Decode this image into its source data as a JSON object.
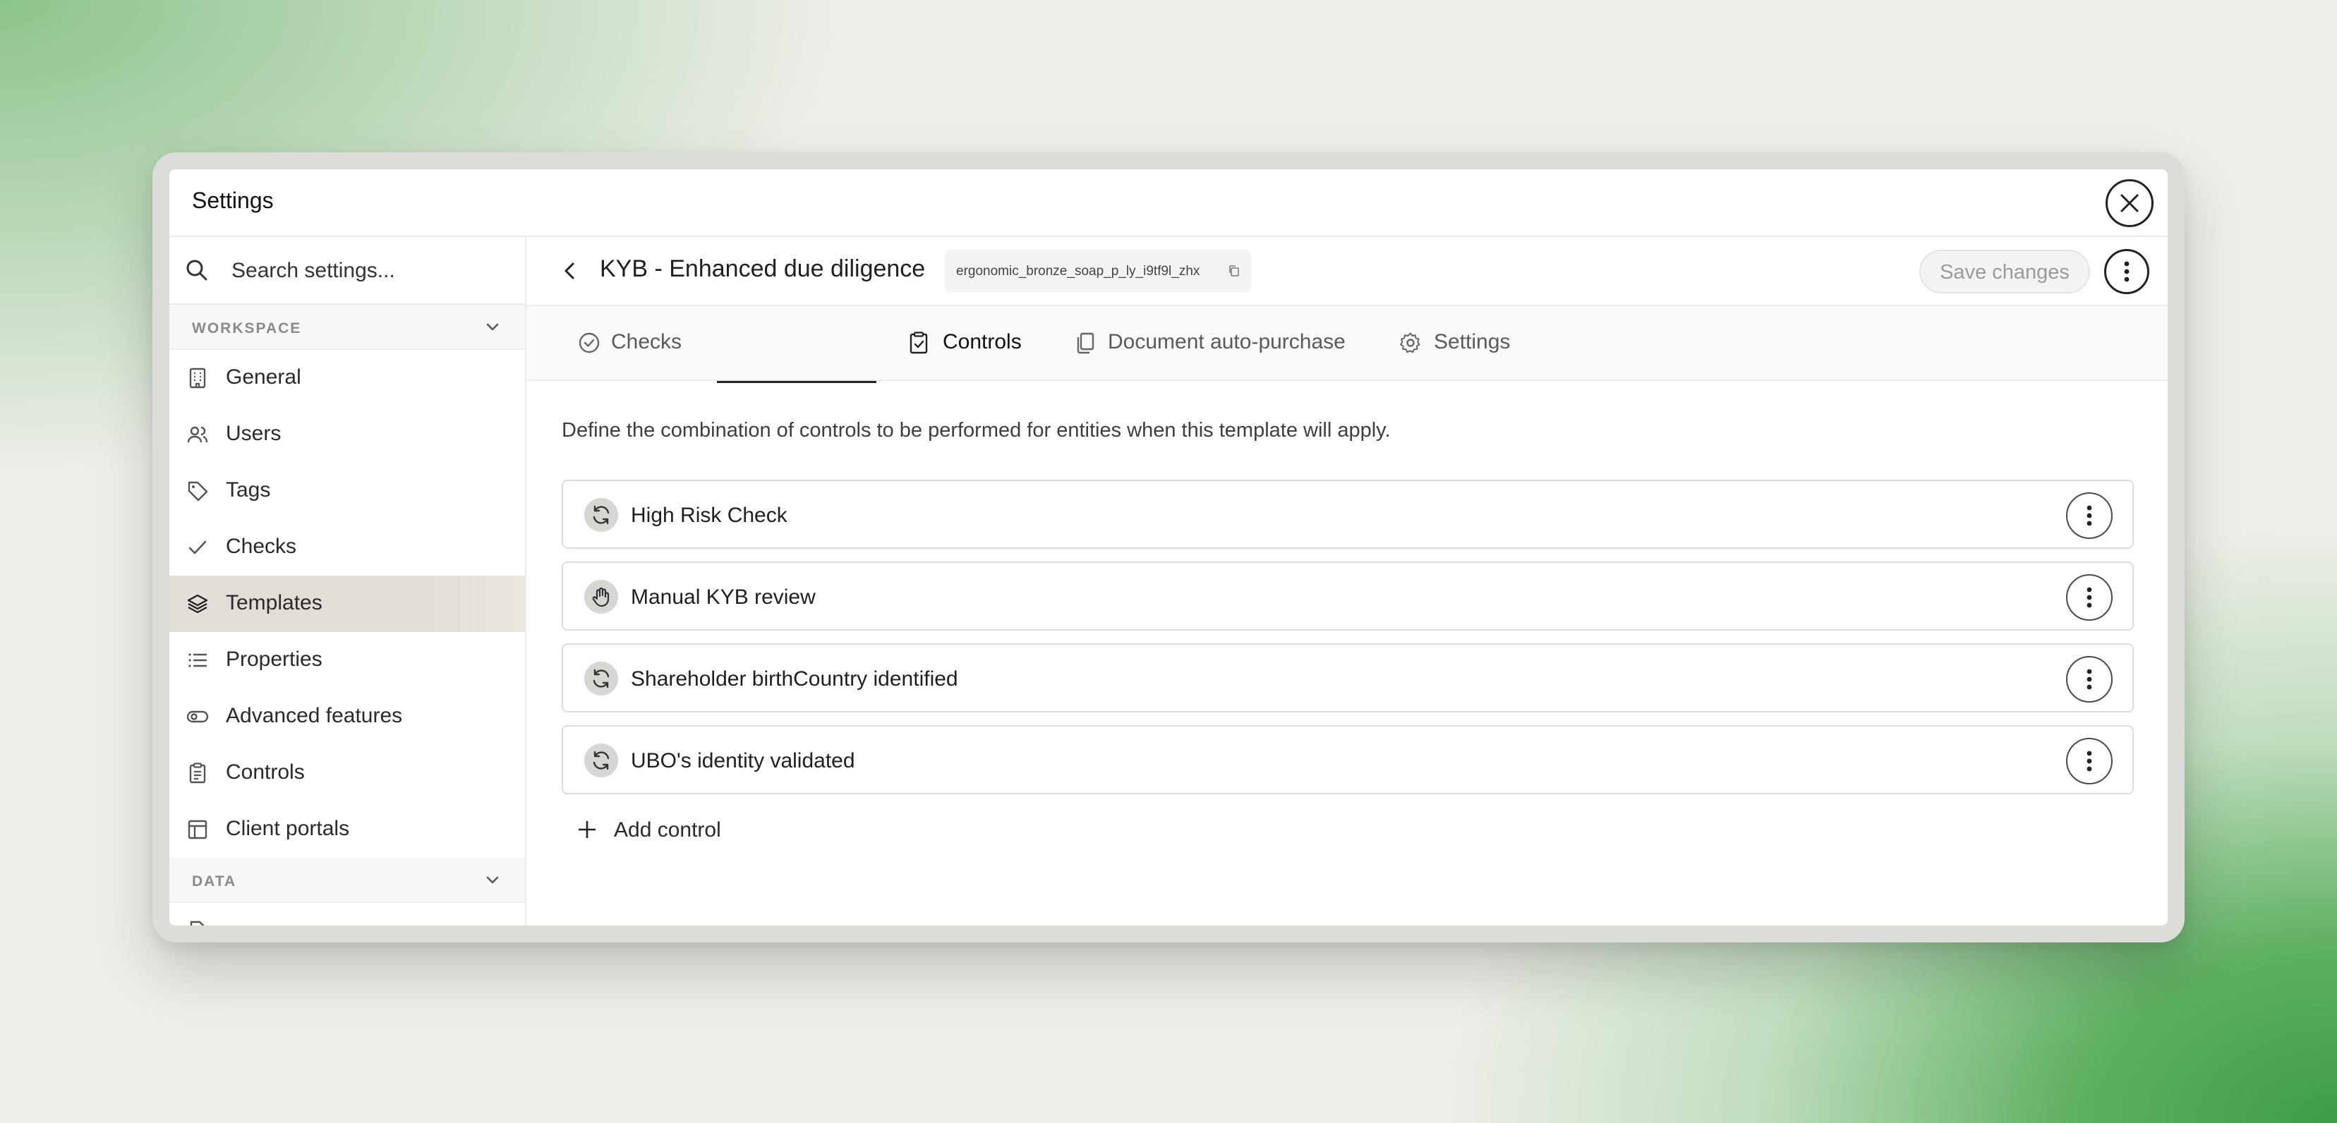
{
  "window": {
    "title": "Settings"
  },
  "sidebar": {
    "search_placeholder": "Search settings...",
    "sections": [
      {
        "label": "WORKSPACE"
      },
      {
        "label": "DATA"
      }
    ],
    "items": [
      {
        "label": "General",
        "icon": "building-icon"
      },
      {
        "label": "Users",
        "icon": "users-icon"
      },
      {
        "label": "Tags",
        "icon": "tag-icon"
      },
      {
        "label": "Checks",
        "icon": "check-icon"
      },
      {
        "label": "Templates",
        "icon": "layers-icon",
        "active": true
      },
      {
        "label": "Properties",
        "icon": "list-icon"
      },
      {
        "label": "Advanced features",
        "icon": "toggle-icon"
      },
      {
        "label": "Controls",
        "icon": "clipboard-icon"
      },
      {
        "label": "Client portals",
        "icon": "layout-icon"
      }
    ]
  },
  "template": {
    "title": "KYB - Enhanced due diligence",
    "id": "ergonomic_bronze_soap_p_ly_i9tf9l_zhx",
    "save_label": "Save changes"
  },
  "tabs": [
    {
      "label": "Checks",
      "icon": "check-circle-icon"
    },
    {
      "label": "Controls",
      "icon": "clipboard-check-icon",
      "active": true
    },
    {
      "label": "Document auto-purchase",
      "icon": "documents-icon"
    },
    {
      "label": "Settings",
      "icon": "gear-icon"
    }
  ],
  "controls": {
    "description": "Define the combination of controls to be performed for entities when this template will apply.",
    "items": [
      {
        "label": "High Risk Check",
        "icon": "refresh-icon"
      },
      {
        "label": "Manual KYB review",
        "icon": "hand-icon"
      },
      {
        "label": "Shareholder birthCountry identified",
        "icon": "refresh-icon"
      },
      {
        "label": "UBO's identity validated",
        "icon": "refresh-icon"
      }
    ],
    "add_label": "Add control"
  },
  "colors": {
    "accent": "#222222",
    "active_nav": "#e3ddd8",
    "background_green": "#3d9d47"
  }
}
